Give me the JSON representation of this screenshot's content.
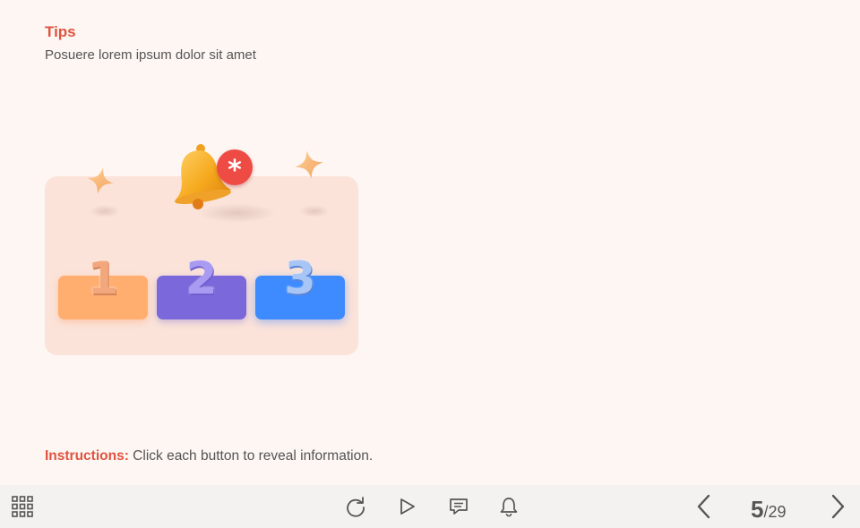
{
  "slide": {
    "title": "Tips",
    "subtitle": "Posuere lorem ipsum dolor sit amet",
    "buttons": [
      {
        "label": "1",
        "color": "#ffae70"
      },
      {
        "label": "2",
        "color": "#7b68da"
      },
      {
        "label": "3",
        "color": "#3d8bff"
      }
    ],
    "notification_badge": "*",
    "instructions_label": "Instructions:",
    "instructions_text": " Click each button to reveal information."
  },
  "toolbar": {
    "menu_icon": "grid-icon",
    "controls": [
      "replay-icon",
      "play-icon",
      "comment-icon",
      "notification-bell-icon"
    ],
    "prev_icon": "chevron-left-icon",
    "next_icon": "chevron-right-icon",
    "current_page": "5",
    "total_pages": "/29"
  },
  "colors": {
    "accent": "#e0533f",
    "background": "#fdf6f3",
    "card": "#fbe3d9",
    "toolbar": "#f3f2f1"
  }
}
